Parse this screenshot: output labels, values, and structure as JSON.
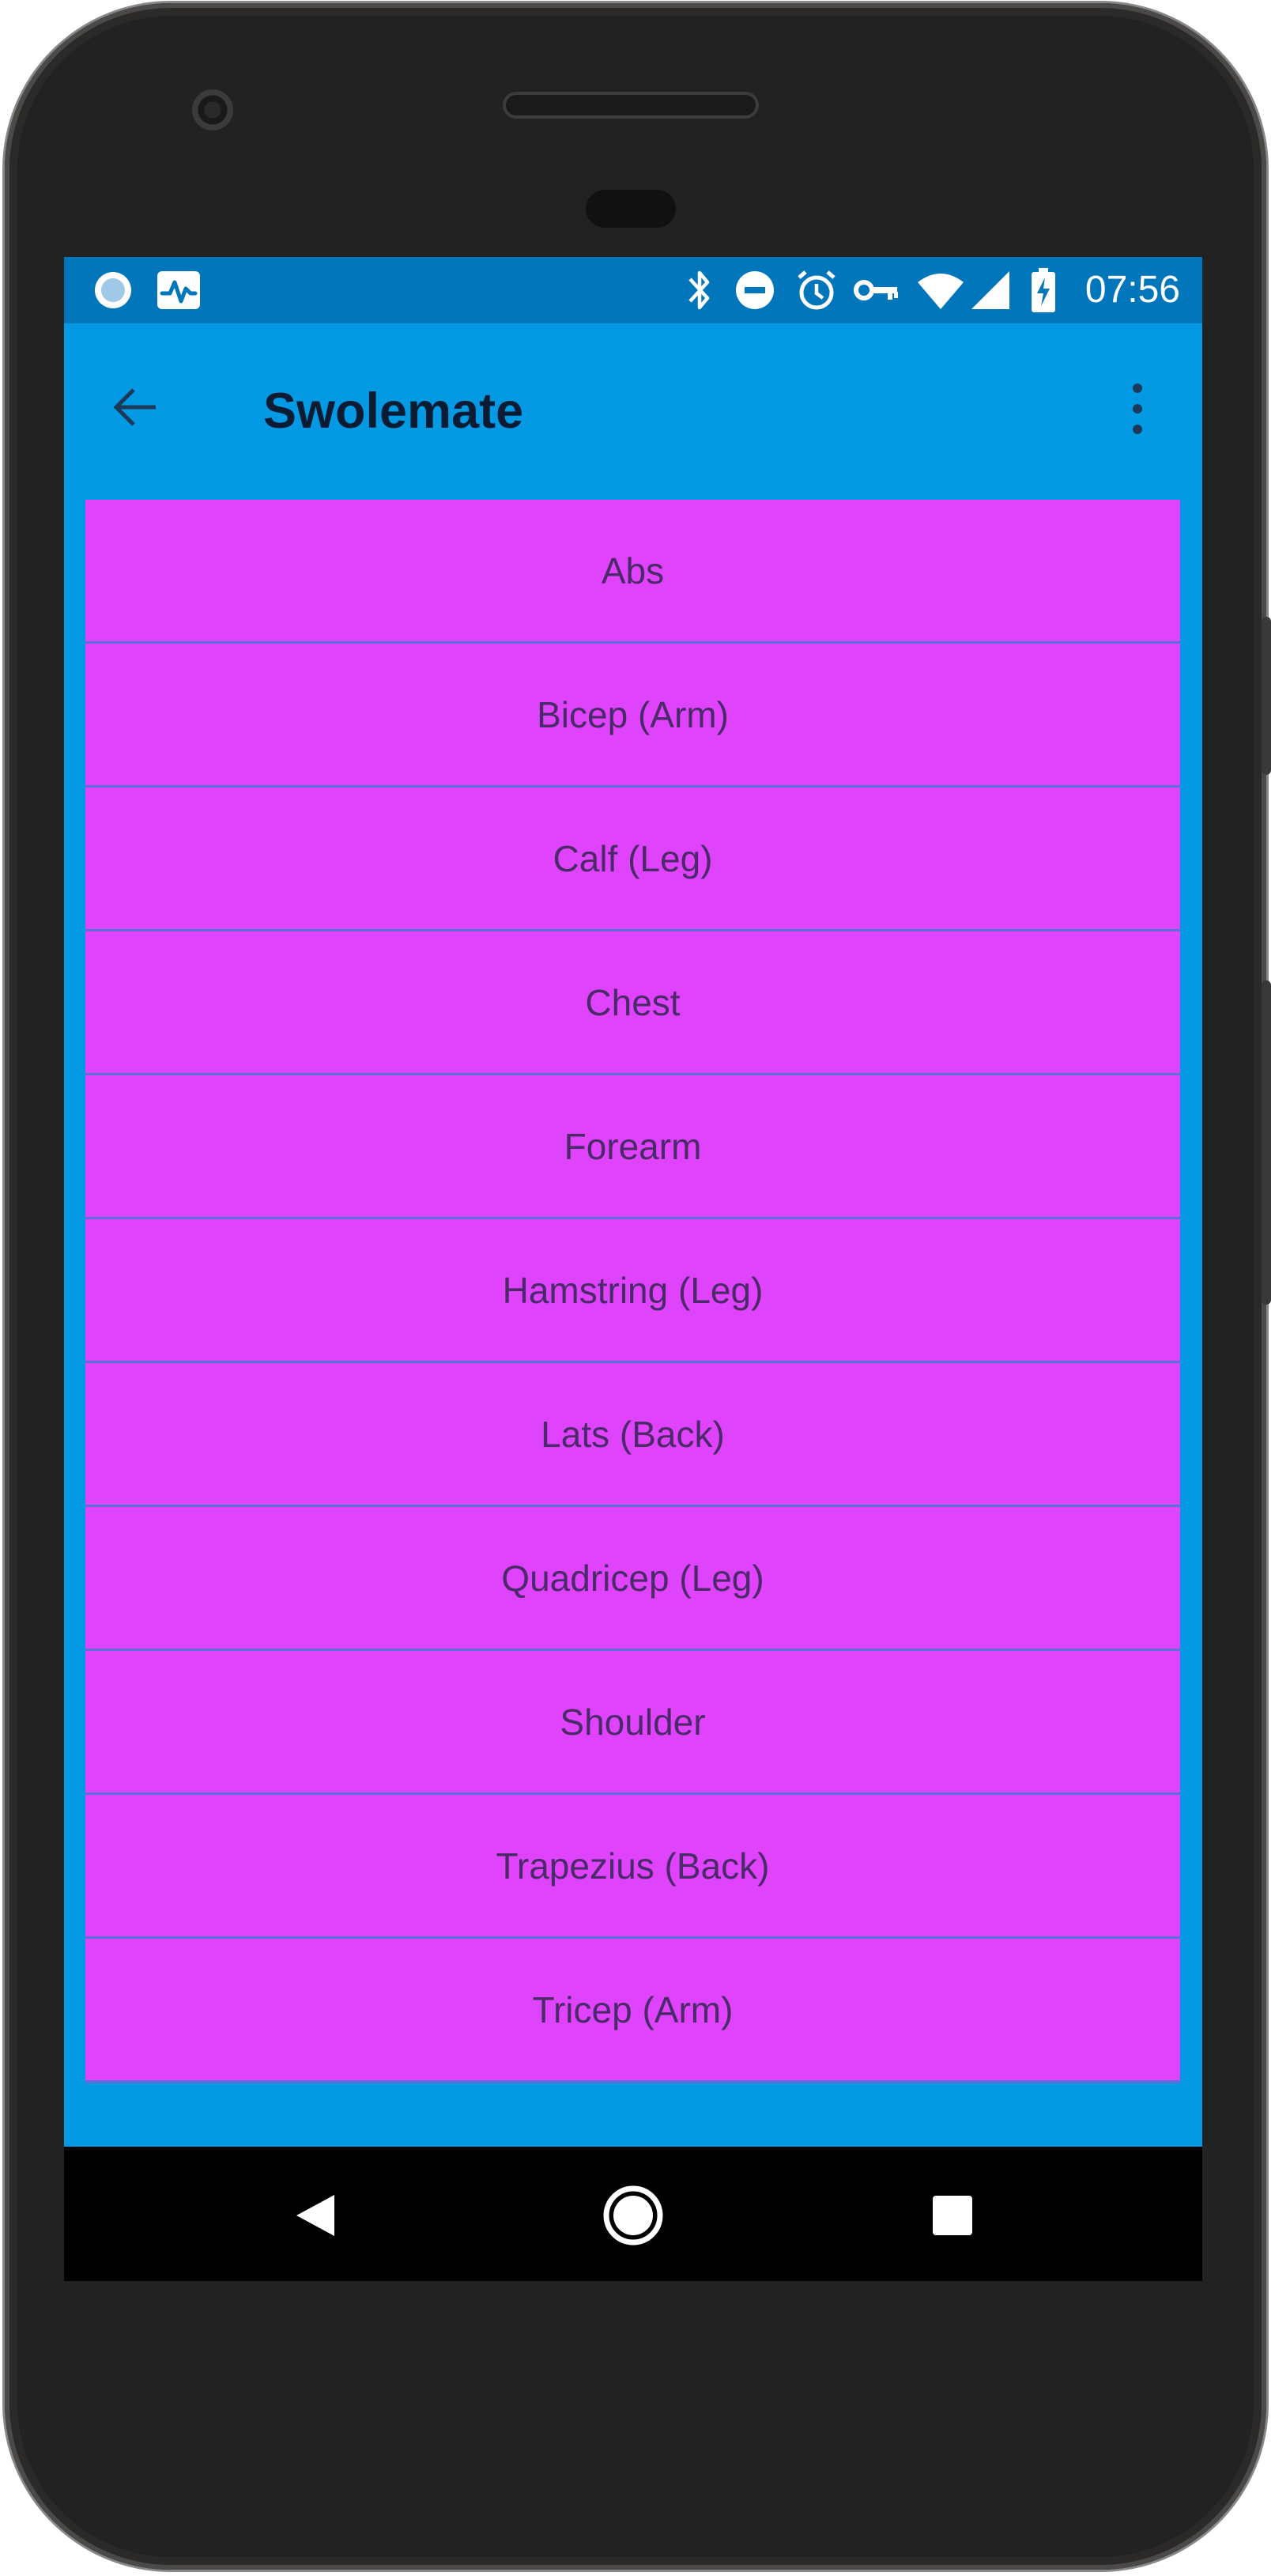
{
  "status_bar": {
    "time": "07:56",
    "left_icons": [
      "circle-notification-icon",
      "activity-monitor-icon"
    ],
    "right_icons": [
      "bluetooth-icon",
      "do-not-disturb-icon",
      "alarm-icon",
      "vpn-key-icon",
      "wifi-icon",
      "signal-icon",
      "battery-charging-icon"
    ]
  },
  "app_bar": {
    "title": "Swolemate",
    "back_icon": "arrow-back-icon",
    "menu_icon": "more-vert-icon"
  },
  "muscle_groups": [
    "Abs",
    "Bicep (Arm)",
    "Calf (Leg)",
    "Chest",
    "Forearm",
    "Hamstring (Leg)",
    "Lats (Back)",
    "Quadricep (Leg)",
    "Shoulder",
    "Trapezius (Back)",
    "Tricep (Arm)"
  ],
  "nav_bar": {
    "icons": [
      "nav-back-icon",
      "nav-home-icon",
      "nav-recents-icon"
    ]
  },
  "colors": {
    "status_bar": "#0276ba",
    "app_background": "#0399e3",
    "list_item": "#df43fb",
    "list_divider": "#5c6fd8",
    "item_text": "#4a2a68",
    "title_text": "#0a1c33"
  }
}
